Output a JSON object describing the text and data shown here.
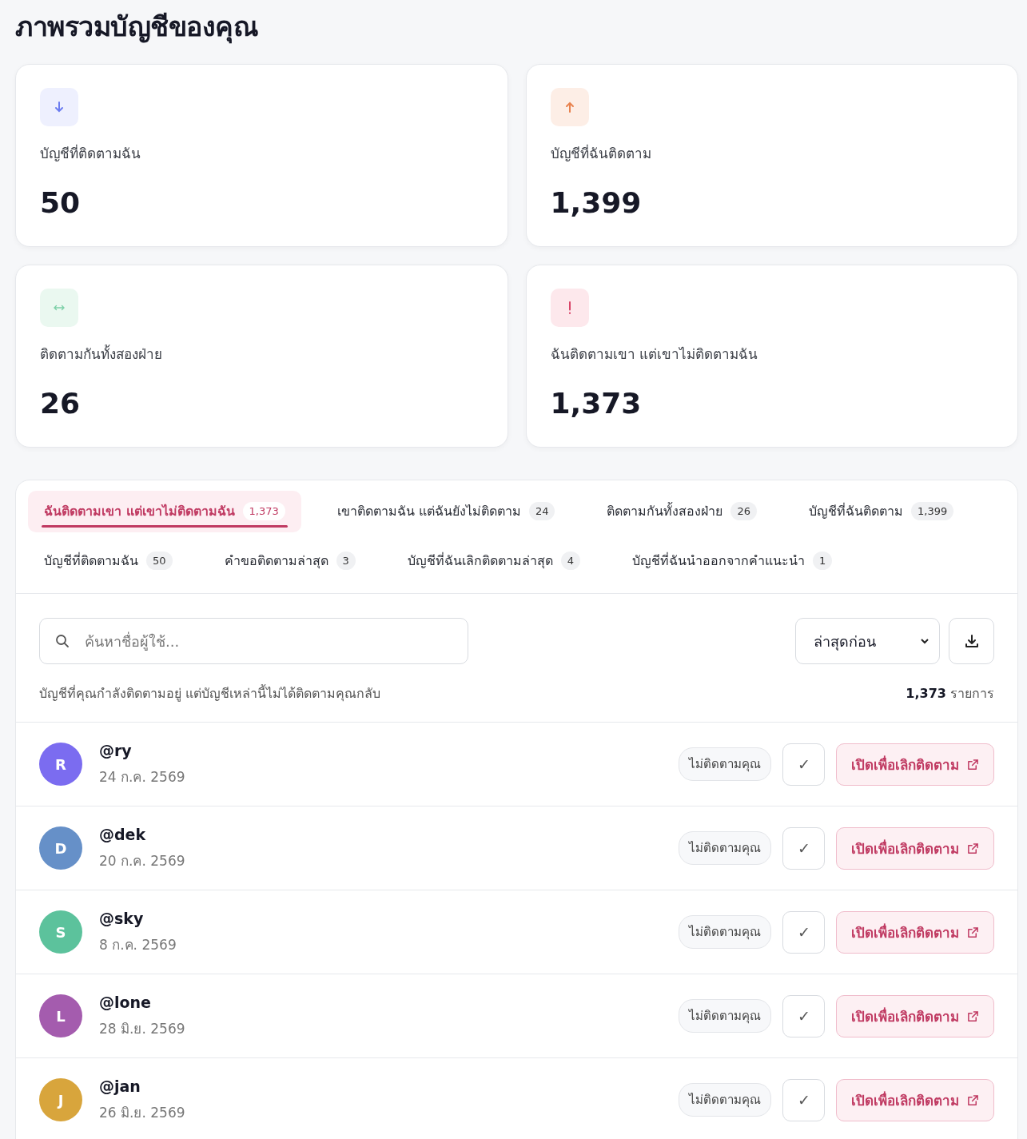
{
  "page_title": "ภาพรวมบัญชีของคุณ",
  "stats": [
    {
      "kind": "down",
      "label": "บัญชีที่ติดตามฉัน",
      "value": "50"
    },
    {
      "kind": "up",
      "label": "บัญชีที่ฉันติดตาม",
      "value": "1,399"
    },
    {
      "kind": "mutual",
      "label": "ติดตามกันทั้งสองฝ่าย",
      "value": "26"
    },
    {
      "kind": "alert",
      "label": "ฉันติดตามเขา แต่เขาไม่ติดตามฉัน",
      "value": "1,373"
    }
  ],
  "tabs": [
    {
      "label": "ฉันติดตามเขา แต่เขาไม่ติดตามฉัน",
      "count": "1,373",
      "selected": true
    },
    {
      "label": "เขาติดตามฉัน แต่ฉันยังไม่ติดตาม",
      "count": "24",
      "selected": false
    },
    {
      "label": "ติดตามกันทั้งสองฝ่าย",
      "count": "26",
      "selected": false
    },
    {
      "label": "บัญชีที่ฉันติดตาม",
      "count": "1,399",
      "selected": false
    },
    {
      "label": "บัญชีที่ติดตามฉัน",
      "count": "50",
      "selected": false
    },
    {
      "label": "คำขอติดตามล่าสุด",
      "count": "3",
      "selected": false
    },
    {
      "label": "บัญชีที่ฉันเลิกติดตามล่าสุด",
      "count": "4",
      "selected": false
    },
    {
      "label": "บัญชีที่ฉันนำออกจากคำแนะนำ",
      "count": "1",
      "selected": false
    }
  ],
  "search": {
    "placeholder": "ค้นหาชื่อผู้ใช้..."
  },
  "sort": {
    "value": "ล่าสุดก่อน"
  },
  "description": "บัญชีที่คุณกำลังติดตามอยู่ แต่บัญชีเหล่านี้ไม่ได้ติดตามคุณกลับ",
  "total": {
    "count": "1,373",
    "unit": "รายการ"
  },
  "accounts": [
    {
      "initial": "R",
      "color": "#7b6cf0",
      "username": "@ry",
      "date": "24 ก.ค. 2569",
      "status": "ไม่ติดตามคุณ",
      "check": "✓",
      "action": "เปิดเพื่อเลิกติดตาม"
    },
    {
      "initial": "D",
      "color": "#6690c8",
      "username": "@dek",
      "date": "20 ก.ค. 2569",
      "status": "ไม่ติดตามคุณ",
      "check": "✓",
      "action": "เปิดเพื่อเลิกติดตาม"
    },
    {
      "initial": "S",
      "color": "#5cc29c",
      "username": "@sky",
      "date": "8 ก.ค. 2569",
      "status": "ไม่ติดตามคุณ",
      "check": "✓",
      "action": "เปิดเพื่อเลิกติดตาม"
    },
    {
      "initial": "L",
      "color": "#a45cae",
      "username": "@lone",
      "date": "28 มิ.ย. 2569",
      "status": "ไม่ติดตามคุณ",
      "check": "✓",
      "action": "เปิดเพื่อเลิกติดตาม"
    },
    {
      "initial": "J",
      "color": "#d8a53c",
      "username": "@jan",
      "date": "26 มิ.ย. 2569",
      "status": "ไม่ติดตามคุณ",
      "check": "✓",
      "action": "เปิดเพื่อเลิกติดตาม"
    }
  ]
}
